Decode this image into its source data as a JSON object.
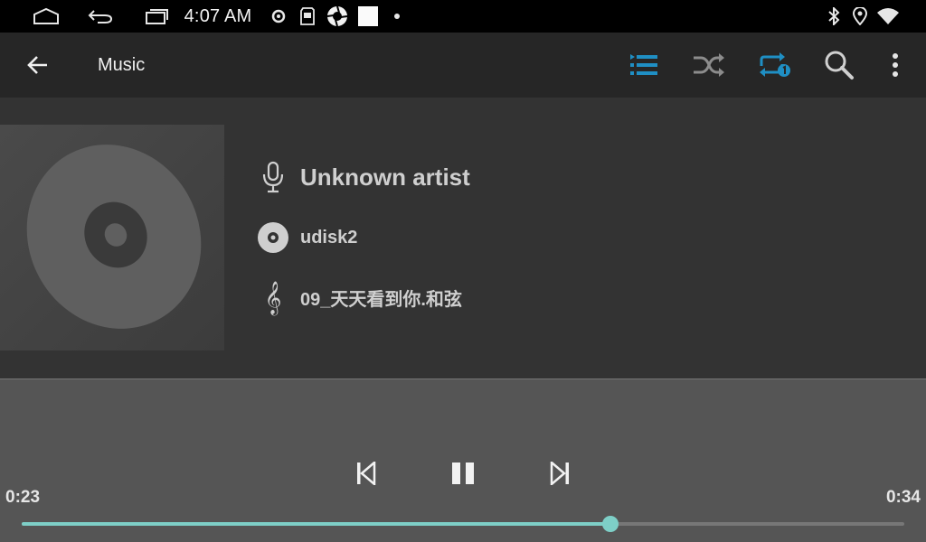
{
  "status_bar": {
    "time": "4:07 AM",
    "icons": [
      "home-icon",
      "back-icon",
      "recents-icon",
      "circle-dot-icon",
      "sd-card-icon",
      "shutter-icon",
      "white-square-icon",
      "notification-dot-icon",
      "bluetooth-icon",
      "location-icon",
      "wifi-icon"
    ]
  },
  "app_bar": {
    "title": "Music",
    "actions": [
      "playlist-icon",
      "shuffle-icon",
      "repeat-one-icon",
      "search-icon",
      "more-icon"
    ],
    "accent_color": "#1f8fc4"
  },
  "track": {
    "artist": "Unknown artist",
    "album": "udisk2",
    "title": "09_天天看到你.和弦"
  },
  "playback": {
    "elapsed": "0:23",
    "duration": "0:34",
    "progress_fraction": 0.667,
    "state": "playing",
    "accent_color": "#7ecfc7"
  }
}
